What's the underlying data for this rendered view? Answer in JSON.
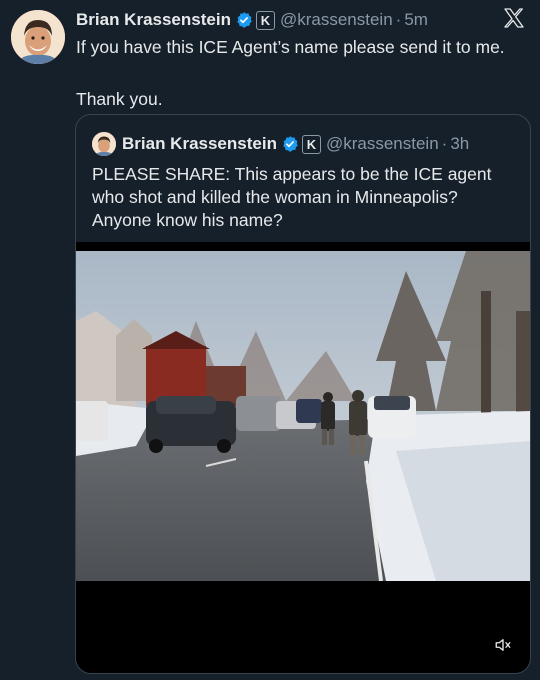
{
  "tweet": {
    "author_name": "Brian Krassenstein",
    "affiliate_label": "K",
    "handle": "@krassenstein",
    "separator": "·",
    "time": "5m",
    "paragraphs": [
      "If you have this ICE Agent’s name please send it to me.",
      "Thank you."
    ]
  },
  "quoted": {
    "author_name": "Brian Krassenstein",
    "affiliate_label": "K",
    "handle": "@krassenstein",
    "separator": "·",
    "time": "3h",
    "text": "PLEASE SHARE: This appears to be the ICE agent who shot and killed the woman in Minneapolis? Anyone know his name?"
  },
  "icons": {
    "verified": "verified-badge-icon",
    "logo": "x-logo-icon",
    "mute": "speaker-muted-icon"
  },
  "colors": {
    "background": "#15202b",
    "text": "#e7e9ea",
    "muted": "#8b98a5",
    "verified": "#1d9bf0",
    "border": "#38444d"
  }
}
